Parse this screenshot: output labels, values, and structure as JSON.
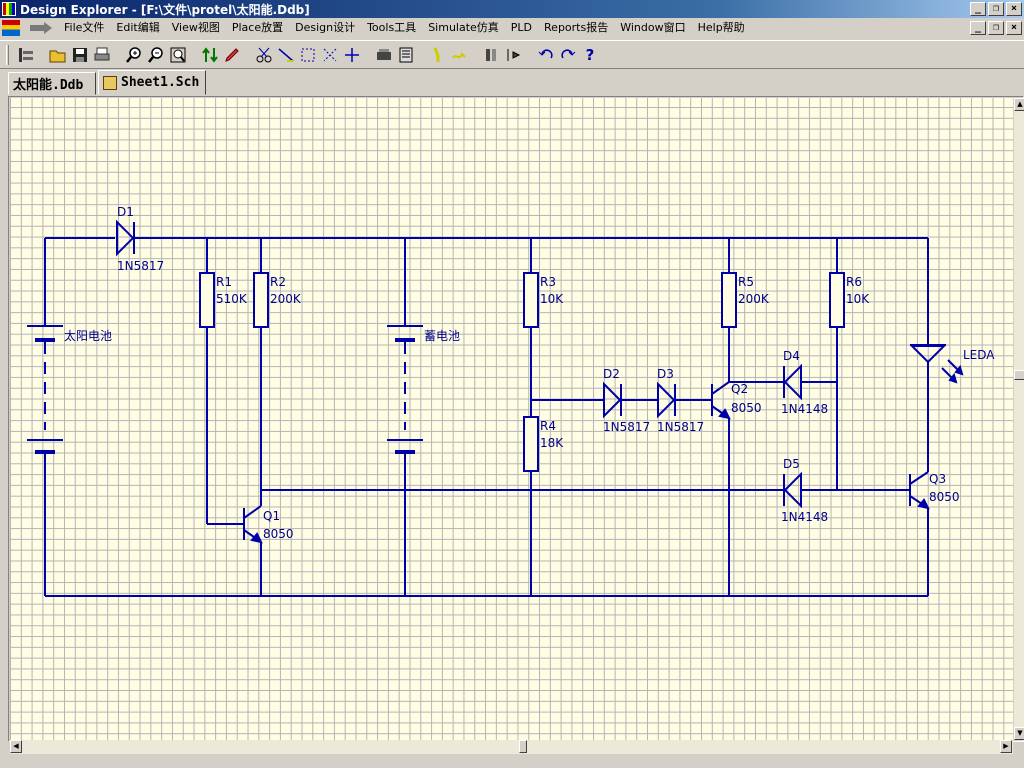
{
  "window": {
    "title": "Design Explorer - [F:\\文件\\protel\\太阳能.Ddb]"
  },
  "menu": {
    "items": [
      "File文件",
      "Edit编辑",
      "View视图",
      "Place放置",
      "Design设计",
      "Tools工具",
      "Simulate仿真",
      "PLD",
      "Reports报告",
      "Window窗口",
      "Help帮助"
    ]
  },
  "toolbar": {
    "icons": [
      "design-manager-icon",
      "open-icon",
      "save-icon",
      "print-icon",
      "zoom-in-icon",
      "zoom-out-icon",
      "zoom-fit-icon",
      "hierarchy-icon",
      "edit-icon",
      "cut-icon",
      "wire-icon",
      "select-icon",
      "deselect-icon",
      "move-icon",
      "library-icon",
      "browse-icon",
      "probe-icon",
      "highlight-icon",
      "annotate-icon",
      "cross-probe-icon",
      "undo-icon",
      "redo-icon",
      "help-icon"
    ]
  },
  "tabs": [
    {
      "label": "太阳能.Ddb"
    },
    {
      "label": "Sheet1.Sch"
    }
  ],
  "schematic": {
    "D1": {
      "ref": "D1",
      "value": "1N5817"
    },
    "R1": {
      "ref": "R1",
      "value": "510K"
    },
    "R2": {
      "ref": "R2",
      "value": "200K"
    },
    "B1": {
      "label": "太阳电池"
    },
    "B2": {
      "label": "蓄电池"
    },
    "R3": {
      "ref": "R3",
      "value": "10K"
    },
    "R4": {
      "ref": "R4",
      "value": "18K"
    },
    "R5": {
      "ref": "R5",
      "value": "200K"
    },
    "R6": {
      "ref": "R6",
      "value": "10K"
    },
    "D2": {
      "ref": "D2",
      "value": "1N5817"
    },
    "D3": {
      "ref": "D3",
      "value": "1N5817"
    },
    "D4": {
      "ref": "D4",
      "value": "1N4148"
    },
    "D5": {
      "ref": "D5",
      "value": "1N4148"
    },
    "Q1": {
      "ref": "Q1",
      "value": "8050"
    },
    "Q2": {
      "ref": "Q2",
      "value": "8050"
    },
    "Q3": {
      "ref": "Q3",
      "value": "8050"
    },
    "LED": {
      "ref": "LEDA"
    }
  },
  "colors": {
    "wire": "#0000aa",
    "sheet": "#fffde3",
    "grid": "#b4b4b4",
    "title_bar": "#0a246a"
  }
}
